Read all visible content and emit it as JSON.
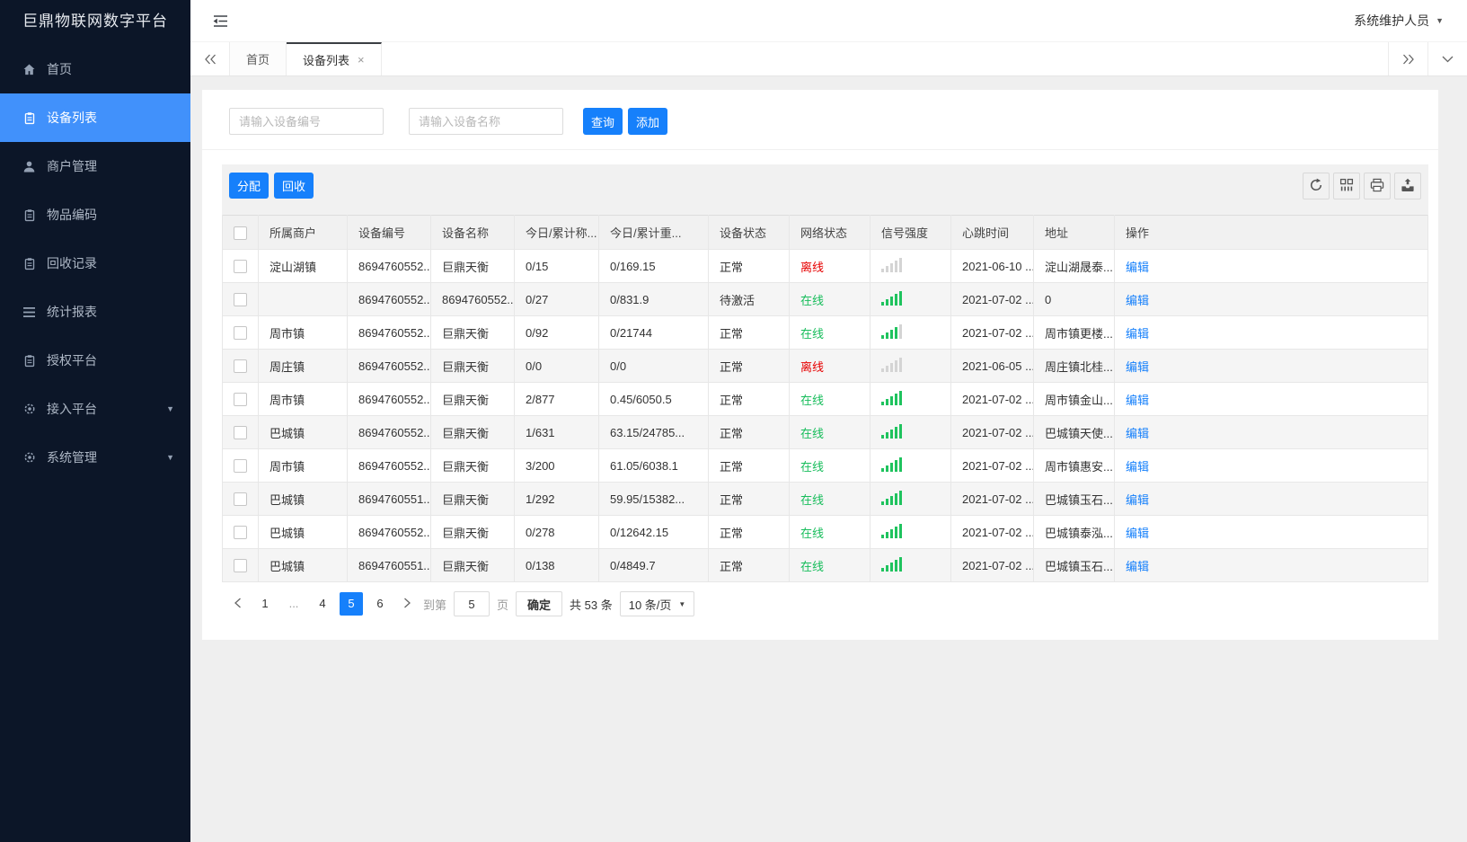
{
  "app": {
    "title": "巨鼎物联网数字平台",
    "user_name": "系统维护人员"
  },
  "sidebar": {
    "items": [
      {
        "name": "home",
        "label": "首页",
        "icon": "home-icon",
        "active": false,
        "expandable": false
      },
      {
        "name": "device-list",
        "label": "设备列表",
        "icon": "clipboard-icon",
        "active": true,
        "expandable": false
      },
      {
        "name": "merchant-mgmt",
        "label": "商户管理",
        "icon": "user-icon",
        "active": false,
        "expandable": false
      },
      {
        "name": "item-code",
        "label": "物品编码",
        "icon": "clipboard-icon",
        "active": false,
        "expandable": false
      },
      {
        "name": "recycle-records",
        "label": "回收记录",
        "icon": "clipboard-icon",
        "active": false,
        "expandable": false
      },
      {
        "name": "stats-report",
        "label": "统计报表",
        "icon": "lines-icon",
        "active": false,
        "expandable": false
      },
      {
        "name": "auth-platform",
        "label": "授权平台",
        "icon": "clipboard-icon",
        "active": false,
        "expandable": false
      },
      {
        "name": "access-platform",
        "label": "接入平台",
        "icon": "gear-icon",
        "active": false,
        "expandable": true
      },
      {
        "name": "system-mgmt",
        "label": "系统管理",
        "icon": "gear-icon",
        "active": false,
        "expandable": true
      }
    ]
  },
  "tabs": {
    "items": [
      {
        "name": "home",
        "label": "首页",
        "active": false,
        "closable": false
      },
      {
        "name": "device-list",
        "label": "设备列表",
        "active": true,
        "closable": true
      }
    ]
  },
  "filters": {
    "device_no_placeholder": "请输入设备编号",
    "device_name_placeholder": "请输入设备名称",
    "search_label": "查询",
    "add_label": "添加"
  },
  "toolbar": {
    "assign_label": "分配",
    "recycle_label": "回收",
    "icons": [
      "refresh-icon",
      "columns-icon",
      "print-icon",
      "export-icon"
    ]
  },
  "table": {
    "columns": [
      "所属商户",
      "设备编号",
      "设备名称",
      "今日/累计称...",
      "今日/累计重...",
      "设备状态",
      "网络状态",
      "信号强度",
      "心跳时间",
      "地址",
      "操作"
    ],
    "rows": [
      {
        "merchant": "淀山湖镇",
        "device_no": "8694760552...",
        "device_name": "巨鼎天衡",
        "weigh_count": "0/15",
        "weight_total": "0/169.15",
        "device_status": "正常",
        "network_status": "离线",
        "network_state": "offline",
        "signal_bars": 0,
        "heartbeat": "2021-06-10 ...",
        "address": "淀山湖晟泰...",
        "action": "编辑"
      },
      {
        "merchant": "",
        "device_no": "8694760552...",
        "device_name": "8694760552...",
        "weigh_count": "0/27",
        "weight_total": "0/831.9",
        "device_status": "待激活",
        "network_status": "在线",
        "network_state": "online",
        "signal_bars": 5,
        "heartbeat": "2021-07-02 ...",
        "address": "0",
        "action": "编辑"
      },
      {
        "merchant": "周市镇",
        "device_no": "8694760552...",
        "device_name": "巨鼎天衡",
        "weigh_count": "0/92",
        "weight_total": "0/21744",
        "device_status": "正常",
        "network_status": "在线",
        "network_state": "online",
        "signal_bars": 4,
        "heartbeat": "2021-07-02 ...",
        "address": "周市镇更楼...",
        "action": "编辑"
      },
      {
        "merchant": "周庄镇",
        "device_no": "8694760552...",
        "device_name": "巨鼎天衡",
        "weigh_count": "0/0",
        "weight_total": "0/0",
        "device_status": "正常",
        "network_status": "离线",
        "network_state": "offline",
        "signal_bars": 0,
        "heartbeat": "2021-06-05 ...",
        "address": "周庄镇北桂...",
        "action": "编辑"
      },
      {
        "merchant": "周市镇",
        "device_no": "8694760552...",
        "device_name": "巨鼎天衡",
        "weigh_count": "2/877",
        "weight_total": "0.45/6050.5",
        "device_status": "正常",
        "network_status": "在线",
        "network_state": "online",
        "signal_bars": 5,
        "heartbeat": "2021-07-02 ...",
        "address": "周市镇金山...",
        "action": "编辑"
      },
      {
        "merchant": "巴城镇",
        "device_no": "8694760552...",
        "device_name": "巨鼎天衡",
        "weigh_count": "1/631",
        "weight_total": "63.15/24785...",
        "device_status": "正常",
        "network_status": "在线",
        "network_state": "online",
        "signal_bars": 5,
        "heartbeat": "2021-07-02 ...",
        "address": "巴城镇天使...",
        "action": "编辑"
      },
      {
        "merchant": "周市镇",
        "device_no": "8694760552...",
        "device_name": "巨鼎天衡",
        "weigh_count": "3/200",
        "weight_total": "61.05/6038.1",
        "device_status": "正常",
        "network_status": "在线",
        "network_state": "online",
        "signal_bars": 5,
        "heartbeat": "2021-07-02 ...",
        "address": "周市镇惠安...",
        "action": "编辑"
      },
      {
        "merchant": "巴城镇",
        "device_no": "8694760551...",
        "device_name": "巨鼎天衡",
        "weigh_count": "1/292",
        "weight_total": "59.95/15382...",
        "device_status": "正常",
        "network_status": "在线",
        "network_state": "online",
        "signal_bars": 5,
        "heartbeat": "2021-07-02 ...",
        "address": "巴城镇玉石...",
        "action": "编辑"
      },
      {
        "merchant": "巴城镇",
        "device_no": "8694760552...",
        "device_name": "巨鼎天衡",
        "weigh_count": "0/278",
        "weight_total": "0/12642.15",
        "device_status": "正常",
        "network_status": "在线",
        "network_state": "online",
        "signal_bars": 5,
        "heartbeat": "2021-07-02 ...",
        "address": "巴城镇泰泓...",
        "action": "编辑"
      },
      {
        "merchant": "巴城镇",
        "device_no": "8694760551...",
        "device_name": "巨鼎天衡",
        "weigh_count": "0/138",
        "weight_total": "0/4849.7",
        "device_status": "正常",
        "network_status": "在线",
        "network_state": "online",
        "signal_bars": 5,
        "heartbeat": "2021-07-02 ...",
        "address": "巴城镇玉石...",
        "action": "编辑"
      }
    ]
  },
  "pagination": {
    "pages": [
      "1",
      "...",
      "4",
      "5",
      "6"
    ],
    "active_page": "5",
    "goto_label": "到第",
    "goto_value": "5",
    "unit_label": "页",
    "confirm_label": "确定",
    "total_label": "共 53 条",
    "page_size": "10 条/页"
  },
  "colors": {
    "primary": "#1680fb",
    "sidebar_active": "#4191fb",
    "online_green": "#17bd5b",
    "offline_red": "#e60000"
  }
}
